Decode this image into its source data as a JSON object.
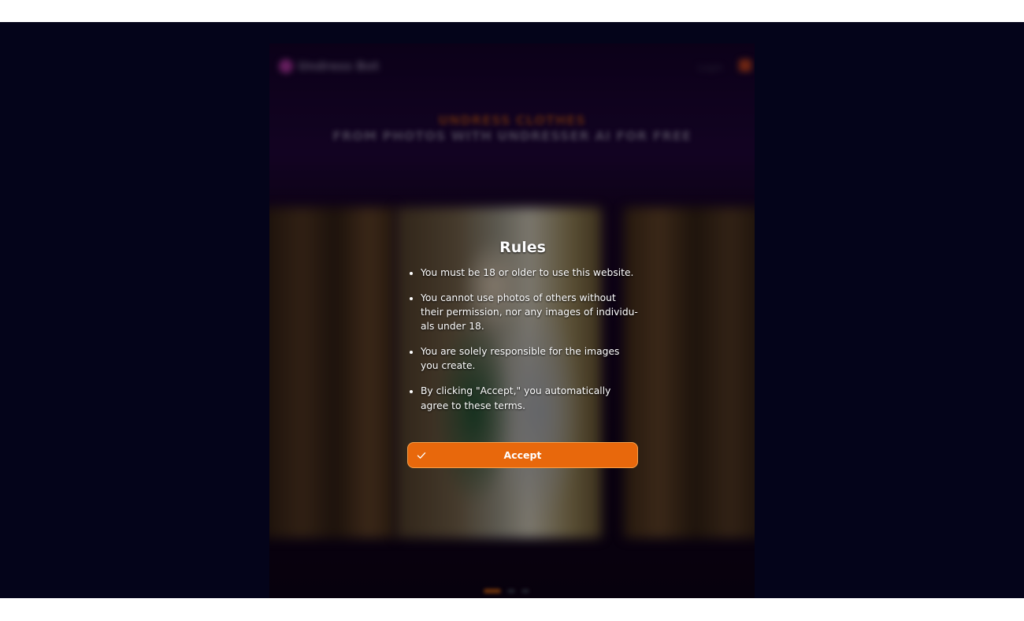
{
  "background_site": {
    "logo_text": "Undress Bot",
    "header_link": "Login",
    "hero_title": "UNDRESS CLOTHES",
    "hero_subtitle": "FROM PHOTOS WITH UNDRESSER AI FOR FREE"
  },
  "modal": {
    "title": "Rules",
    "rules": [
      "You must be 18 or older to use this website.",
      "You cannot use photos of others without their permission, nor any images of individu-als under 18.",
      "You are solely responsible for the images you create.",
      "By clicking \"Accept,\" you automatically agree to these terms."
    ],
    "accept_label": "Accept",
    "accept_icon": "check-icon"
  },
  "colors": {
    "page_backdrop": "#04041a",
    "accent": "#e8680c",
    "text": "#ffffff"
  }
}
